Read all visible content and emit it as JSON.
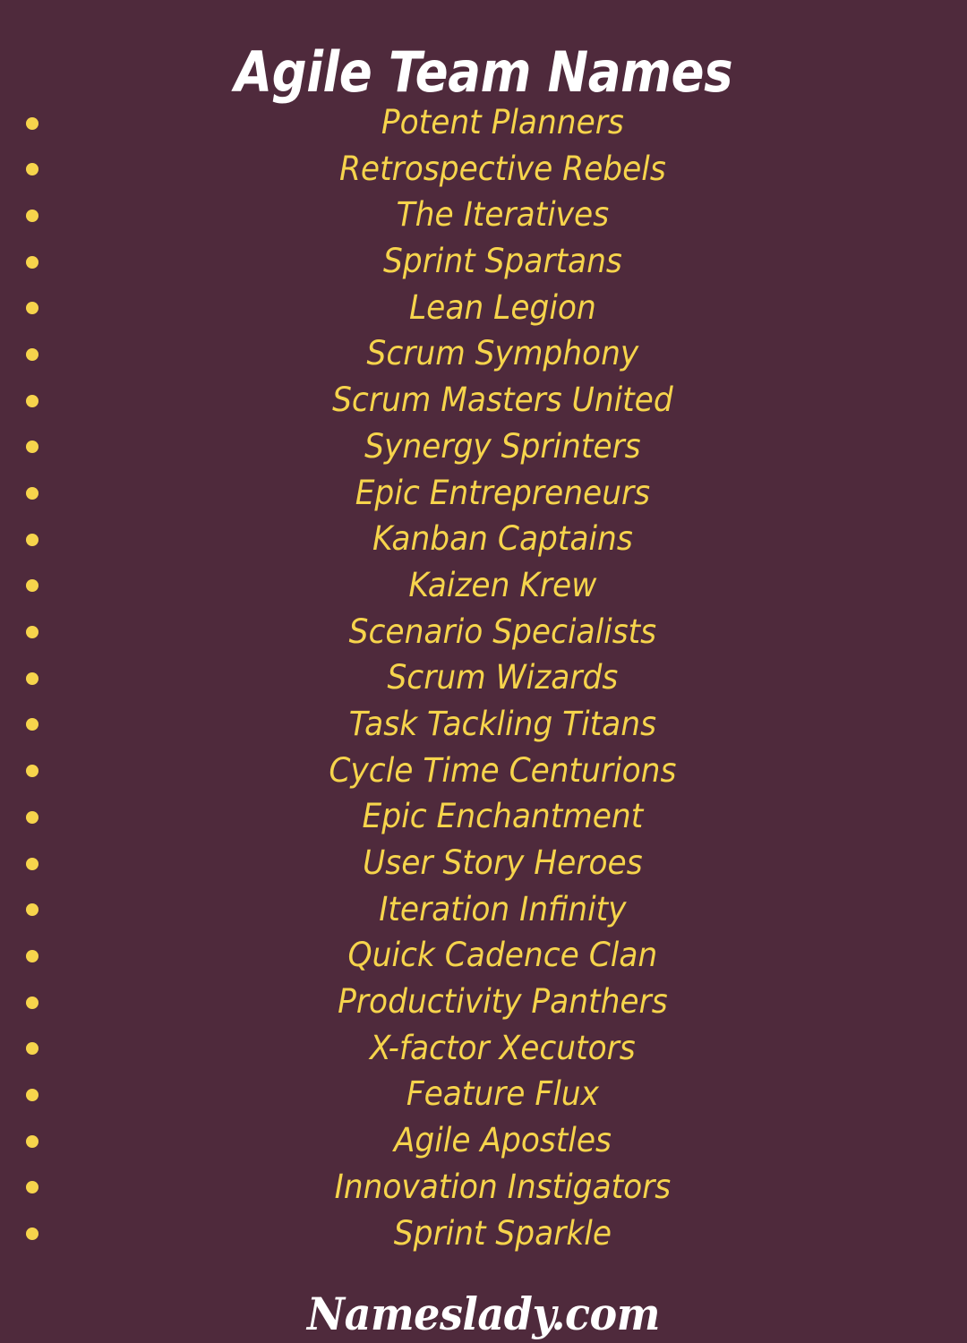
{
  "theme": {
    "background_color": "#4F2A3C",
    "title_color": "#FFFFFF",
    "accent_color": "#F6D44C",
    "footer_color": "#FFFFFF"
  },
  "header": {
    "title": "Agile Team Names"
  },
  "list": {
    "bullet_icon": "bullet-dot-icon",
    "items": [
      {
        "label": "Potent Planners"
      },
      {
        "label": "Retrospective Rebels"
      },
      {
        "label": "The Iteratives"
      },
      {
        "label": "Sprint Spartans"
      },
      {
        "label": "Lean Legion"
      },
      {
        "label": "Scrum Symphony"
      },
      {
        "label": "Scrum Masters United"
      },
      {
        "label": "Synergy Sprinters"
      },
      {
        "label": "Epic Entrepreneurs"
      },
      {
        "label": "Kanban Captains"
      },
      {
        "label": "Kaizen Krew"
      },
      {
        "label": "Scenario Specialists"
      },
      {
        "label": "Scrum Wizards"
      },
      {
        "label": "Task Tackling Titans"
      },
      {
        "label": "Cycle Time Centurions"
      },
      {
        "label": "Epic Enchantment"
      },
      {
        "label": "User Story Heroes"
      },
      {
        "label": "Iteration Infinity"
      },
      {
        "label": "Quick Cadence Clan"
      },
      {
        "label": "Productivity Panthers"
      },
      {
        "label": "X-factor Xecutors"
      },
      {
        "label": "Feature Flux"
      },
      {
        "label": "Agile Apostles"
      },
      {
        "label": "Innovation Instigators"
      },
      {
        "label": "Sprint Sparkle"
      }
    ]
  },
  "footer": {
    "brand": "Nameslady.com"
  }
}
